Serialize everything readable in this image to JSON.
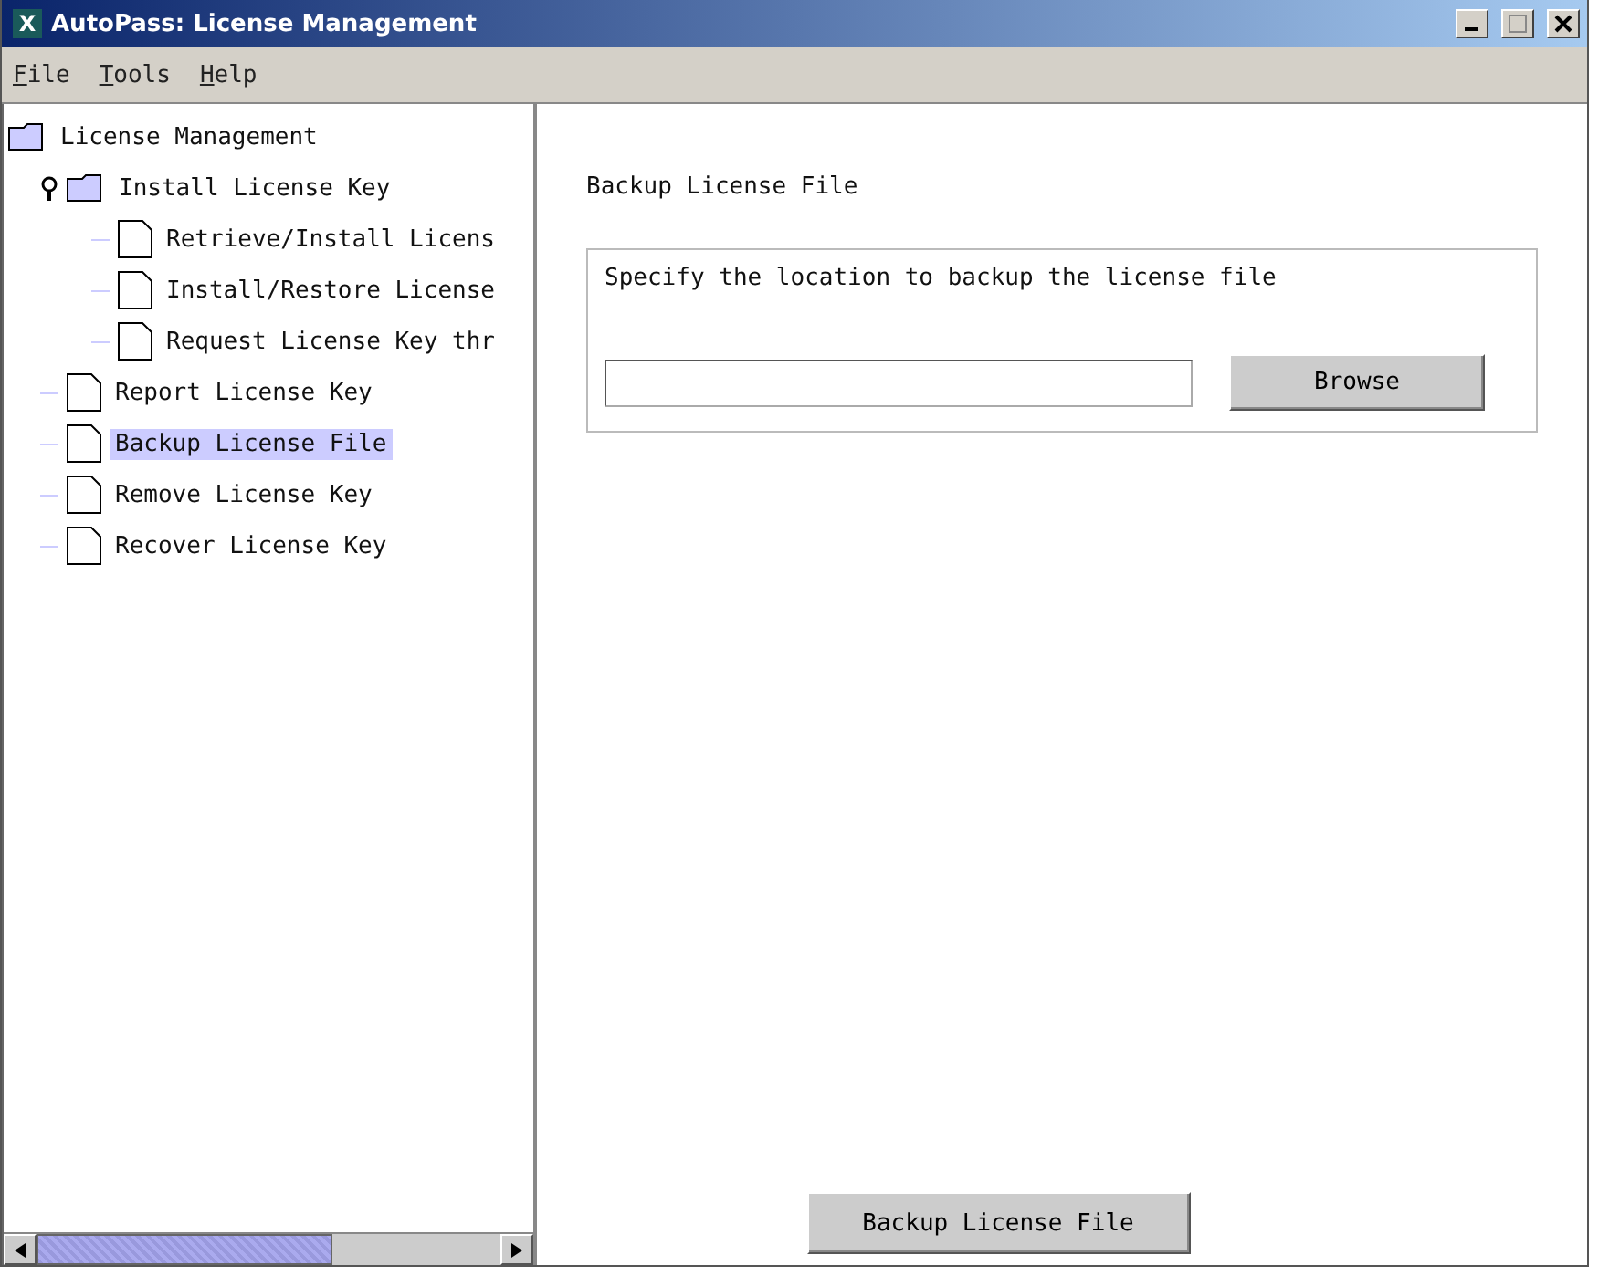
{
  "window": {
    "title": "AutoPass: License Management",
    "app_icon": "X"
  },
  "menu": [
    "File",
    "Tools",
    "Help"
  ],
  "tree": [
    {
      "label": "License Management",
      "kind": "folder",
      "selected": false,
      "children": [
        {
          "label": "Install License Key",
          "kind": "folder",
          "expanded": true,
          "selected": false,
          "children": [
            {
              "label": "Retrieve/Install Licens",
              "kind": "file",
              "selected": false
            },
            {
              "label": "Install/Restore License",
              "kind": "file",
              "selected": false
            },
            {
              "label": "Request License Key thr",
              "kind": "file",
              "selected": false
            }
          ]
        },
        {
          "label": "Report License Key",
          "kind": "file",
          "selected": false
        },
        {
          "label": "Backup License File",
          "kind": "file",
          "selected": true
        },
        {
          "label": "Remove License Key",
          "kind": "file",
          "selected": false
        },
        {
          "label": "Recover License Key",
          "kind": "file",
          "selected": false
        }
      ]
    }
  ],
  "panel": {
    "heading": "Backup License File",
    "group_text": "Specify the location to backup the license file",
    "browse_button": "Browse",
    "action_button": "Backup License File"
  }
}
